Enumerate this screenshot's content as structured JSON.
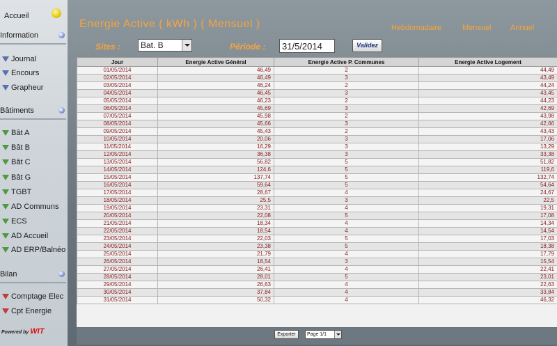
{
  "sidebar": {
    "home_label": "Accueil",
    "sections": [
      {
        "title": "Information",
        "items": [
          "Journal",
          "Encours",
          "Grapheur"
        ]
      },
      {
        "title": "Bâtiments",
        "items": [
          "Bât A",
          "Bât B",
          "Bât C",
          "Bât G",
          "TGBT",
          "AD Communs",
          "ECS",
          "AD Accueil",
          "AD ERP/Balnéo"
        ]
      },
      {
        "title": "Bilan",
        "items": [
          "Comptage Elec",
          "Cpt Energie"
        ]
      }
    ],
    "powered_by": "Powered by",
    "brand": "WIT"
  },
  "header": {
    "title": "Energie Active  ( kWh )  ( Mensuel )",
    "views": [
      "Hebdomadaire",
      "Mensuel",
      "Annuel"
    ]
  },
  "filters": {
    "sites_label": "Sites :",
    "site_value": "Bat. B",
    "period_label": "Période :",
    "period_value": "31/5/2014",
    "validate_label": "Validez"
  },
  "table": {
    "columns": [
      "Jour",
      "Energie Active Général",
      "Energie Active P. Communes",
      "Energie Active Logement"
    ],
    "rows": [
      [
        "01/05/2014",
        "46,49",
        "2",
        "44,49"
      ],
      [
        "02/05/2014",
        "46,49",
        "3",
        "43,49"
      ],
      [
        "03/05/2014",
        "46,24",
        "2",
        "44,24"
      ],
      [
        "04/05/2014",
        "46,45",
        "3",
        "43,45"
      ],
      [
        "05/05/2014",
        "46,23",
        "2",
        "44,23"
      ],
      [
        "06/05/2014",
        "45,69",
        "3",
        "42,69"
      ],
      [
        "07/05/2014",
        "45,98",
        "2",
        "43,98"
      ],
      [
        "08/05/2014",
        "45,66",
        "3",
        "42,66"
      ],
      [
        "09/05/2014",
        "45,43",
        "2",
        "43,43"
      ],
      [
        "10/05/2014",
        "20,06",
        "3",
        "17,06"
      ],
      [
        "11/05/2014",
        "16,29",
        "3",
        "13,29"
      ],
      [
        "12/05/2014",
        "36,38",
        "3",
        "33,38"
      ],
      [
        "13/05/2014",
        "56,82",
        "5",
        "51,82"
      ],
      [
        "14/05/2014",
        "124,6",
        "5",
        "119,6"
      ],
      [
        "15/05/2014",
        "137,74",
        "5",
        "132,74"
      ],
      [
        "16/05/2014",
        "59,64",
        "5",
        "54,64"
      ],
      [
        "17/05/2014",
        "28,67",
        "4",
        "24,67"
      ],
      [
        "18/05/2014",
        "25,5",
        "3",
        "22,5"
      ],
      [
        "19/05/2014",
        "23,31",
        "4",
        "19,31"
      ],
      [
        "20/05/2014",
        "22,08",
        "5",
        "17,08"
      ],
      [
        "21/05/2014",
        "18,34",
        "4",
        "14,34"
      ],
      [
        "22/05/2014",
        "18,54",
        "4",
        "14,54"
      ],
      [
        "23/05/2014",
        "22,03",
        "5",
        "17,03"
      ],
      [
        "24/05/2014",
        "23,38",
        "5",
        "18,38"
      ],
      [
        "25/05/2014",
        "21,79",
        "4",
        "17,79"
      ],
      [
        "26/05/2014",
        "18,54",
        "3",
        "15,54"
      ],
      [
        "27/05/2014",
        "26,41",
        "4",
        "22,41"
      ],
      [
        "28/05/2014",
        "28,01",
        "5",
        "23,01"
      ],
      [
        "29/05/2014",
        "26,63",
        "4",
        "22,63"
      ],
      [
        "30/05/2014",
        "37,84",
        "4",
        "33,84"
      ],
      [
        "31/05/2014",
        "50,32",
        "4",
        "46,32"
      ]
    ]
  },
  "footer": {
    "export_label": "Exporter",
    "page_label": "Page 1/1"
  }
}
